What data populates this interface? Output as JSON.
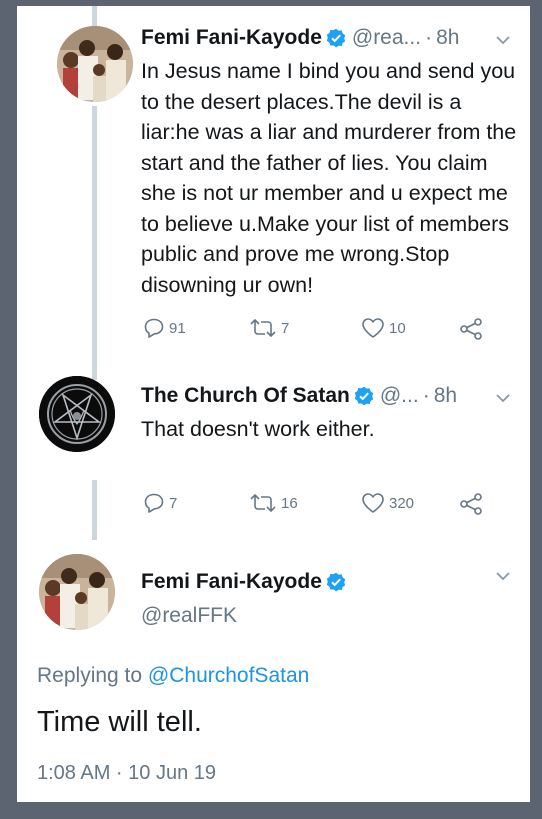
{
  "colors": {
    "link": "#1b95e0",
    "verified": "#1da1f2",
    "muted": "#657786",
    "text": "#14171a"
  },
  "tweets": [
    {
      "name": "Femi Fani-Kayode",
      "handle": "@rea...",
      "time": "8h",
      "text": "In Jesus name I bind you and send you to the desert places.The devil is a liar:he was a liar and murderer from the start and the father of lies. You claim she is not ur member and u expect me to believe u.Make your list of members public and prove me wrong.Stop disowning ur own!",
      "replies": "91",
      "retweets": "7",
      "likes": "10"
    },
    {
      "name": "The Church Of Satan",
      "handle": "@...",
      "time": "8h",
      "text": "That doesn't work either.",
      "replies": "7",
      "retweets": "16",
      "likes": "320"
    }
  ],
  "main_tweet": {
    "name": "Femi Fani-Kayode",
    "handle": "@realFFK",
    "replying_prefix": "Replying to",
    "replying_to": "@ChurchofSatan",
    "text": "Time will tell.",
    "timestamp": "1:08 AM · 10 Jun 19"
  },
  "icons": [
    "verified-badge-icon",
    "chevron-down-icon",
    "reply-icon",
    "retweet-icon",
    "like-icon",
    "share-icon",
    "pentagram-icon"
  ]
}
